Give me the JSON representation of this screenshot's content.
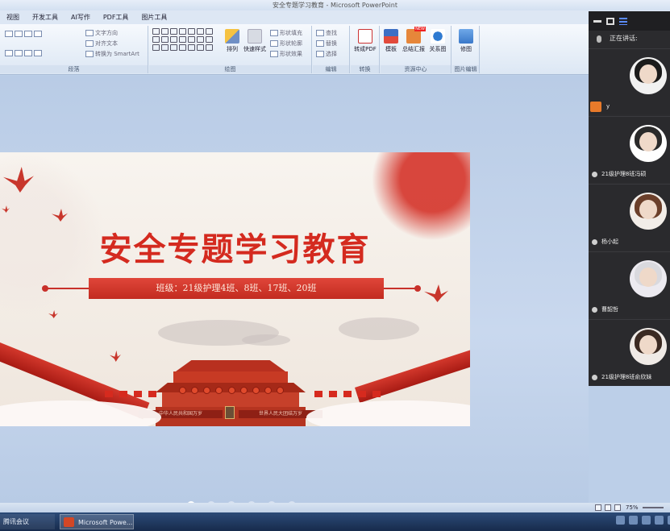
{
  "window": {
    "title": "安全专题学习教育 - Microsoft PowerPoint"
  },
  "menu": {
    "tabs": [
      "视图",
      "开发工具",
      "AI写作",
      "PDF工具",
      "图片工具"
    ]
  },
  "ribbon": {
    "paragraph": {
      "label": "段落",
      "text_direction": "文字方向",
      "align_text": "对齐文本",
      "convert_smartart": "转换为 SmartArt"
    },
    "drawing": {
      "label": "绘图",
      "arrange": "排列",
      "quick_styles": "快速样式",
      "shape_fill": "形状填充",
      "shape_outline": "形状轮廓",
      "shape_effects": "形状效果"
    },
    "editing": {
      "label": "编辑",
      "find": "查找",
      "replace": "替换",
      "select": "选择"
    },
    "convert": {
      "label": "转换",
      "to_pdf": "转成PDF"
    },
    "resources": {
      "label": "资源中心",
      "template": "模板",
      "summary": "总结汇报",
      "relation": "关系图",
      "badge": "NEW"
    },
    "picture": {
      "label": "图片编辑",
      "cutout": "修图"
    }
  },
  "slide": {
    "title": "安全专题学习教育",
    "subtitle": "班级：21级护理4班、8班、17班、20班",
    "banner_left": "中华人民共和国万岁",
    "banner_right": "世界人民大团结万岁"
  },
  "meeting": {
    "speaking_label": "正在讲话:",
    "participants": [
      {
        "name": "y",
        "is_self": true,
        "hair": "#1b1b1b",
        "bg": "#f1f1f1"
      },
      {
        "name": "21级护理8班冯硕",
        "is_self": false,
        "hair": "#2a2a2a",
        "bg": "#ffffff"
      },
      {
        "name": "杨小起",
        "is_self": false,
        "hair": "#6b3f2a",
        "bg": "#f2ede8"
      },
      {
        "name": "曹韶哲",
        "is_self": false,
        "hair": "#d9d9de",
        "bg": "#eceaf0"
      },
      {
        "name": "21级护理8班俞欣妹",
        "is_self": false,
        "hair": "#3b2a22",
        "bg": "#efeae6"
      }
    ]
  },
  "statusbar": {
    "zoom": "75%"
  },
  "taskbar": {
    "items": [
      {
        "label": "腾讯会议"
      },
      {
        "label": "Microsoft Powe..."
      }
    ]
  },
  "colors": {
    "accent_red": "#d42a1f",
    "ribbon_bg": "#dce7f4",
    "panel_bg": "#2b2b2e"
  }
}
